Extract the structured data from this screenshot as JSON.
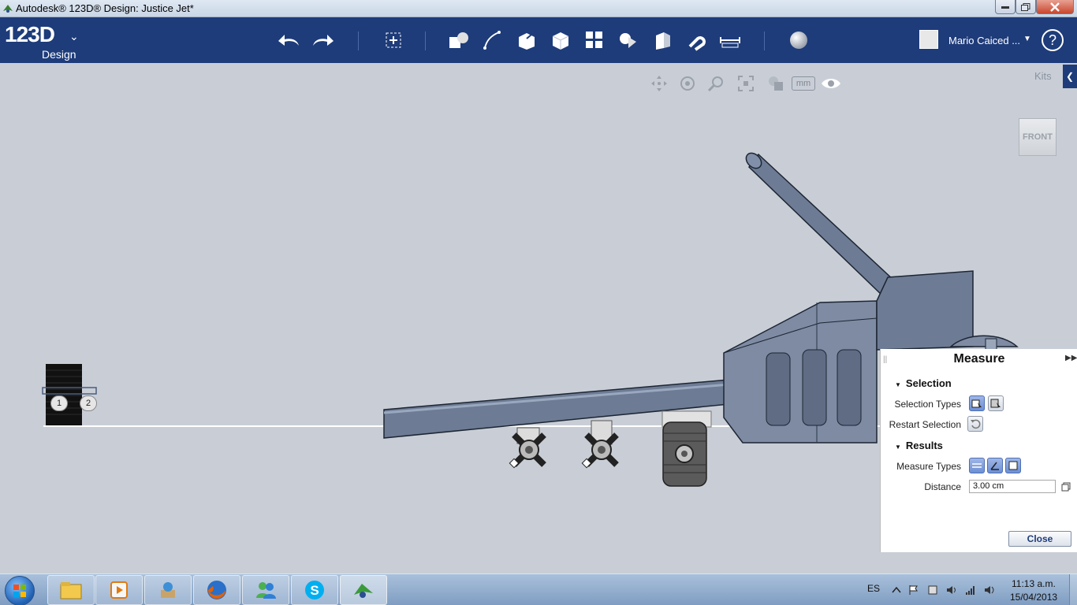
{
  "window": {
    "title": "Autodesk® 123D® Design: Justice Jet*"
  },
  "header": {
    "logo_main": "123D",
    "logo_sub": "Design",
    "user_name": "Mario Caiced ...",
    "help_symbol": "?"
  },
  "viewport": {
    "units_label": "mm",
    "kits_label": "Kits",
    "viewcube_label": "FRONT",
    "point_labels": [
      "1",
      "2"
    ]
  },
  "measure_panel": {
    "title": "Measure",
    "selection_heading": "Selection",
    "selection_types_label": "Selection Types",
    "restart_selection_label": "Restart Selection",
    "results_heading": "Results",
    "measure_types_label": "Measure Types",
    "distance_label": "Distance",
    "distance_value": "3.00 cm",
    "close_label": "Close"
  },
  "taskbar": {
    "language": "ES",
    "time": "11:13 a.m.",
    "date": "15/04/2013"
  },
  "colors": {
    "toolbar": "#1e3c7a",
    "viewport": "#c9ced6",
    "model": "#7e8ba3",
    "active_icon": "#6c8fd6"
  }
}
